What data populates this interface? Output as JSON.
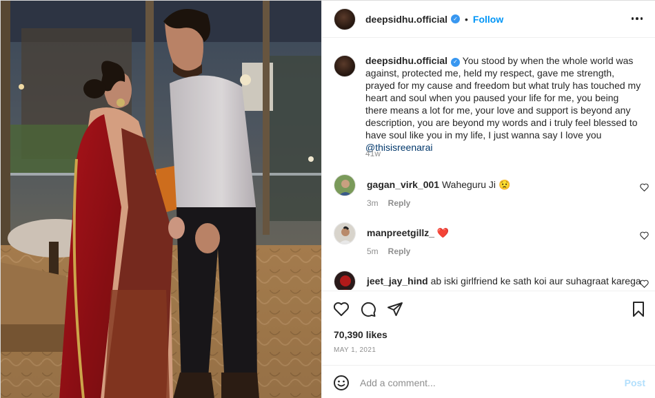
{
  "post": {
    "username": "deepsidhu.official",
    "follow_label": "Follow",
    "dot": "•",
    "verified_icon": "check-icon"
  },
  "caption": {
    "username": "deepsidhu.official",
    "text": "You stood by when the whole world was against, protected me, held my respect, gave me strength, prayed for my cause and freedom but what truly has touched my heart and soul when you paused your life for me, you being there means a lot for me, your love and support is beyond any description, you are beyond my words and i truly feel blessed to have soul like you in my life, I just wanna say I love you",
    "mention": "@thisisreenarai",
    "time_ago": "41w"
  },
  "comments": [
    {
      "username": "gagan_virk_001",
      "text": "Waheguru Ji",
      "emoji": "😟",
      "time": "3m",
      "reply_label": "Reply"
    },
    {
      "username": "manpreetgillz_",
      "text": "",
      "emoji": "❤️",
      "time": "5m",
      "reply_label": "Reply"
    },
    {
      "username": "jeet_jay_hind",
      "text": "ab iski girlfriend ke sath koi aur suhagraat karega",
      "emoji": "",
      "time": "",
      "reply_label": ""
    }
  ],
  "engagement": {
    "likes": "70,390 likes",
    "date": "MAY 1, 2021"
  },
  "add_comment": {
    "placeholder": "Add a comment...",
    "post_label": "Post"
  },
  "colors": {
    "accent": "#0095f6",
    "verified": "#3897f0",
    "muted": "#8e8e8e",
    "post_disabled": "#b2dffc"
  }
}
